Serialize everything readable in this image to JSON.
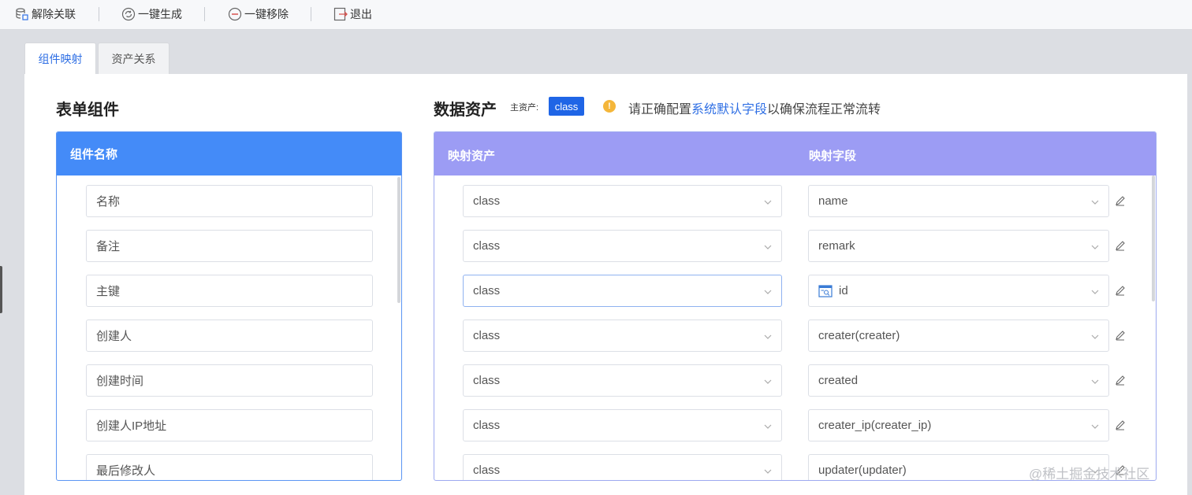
{
  "toolbar": {
    "unlink_label": "解除关联",
    "generate_label": "一键生成",
    "remove_label": "一键移除",
    "exit_label": "退出"
  },
  "tabs": [
    {
      "label": "组件映射",
      "active": true
    },
    {
      "label": "资产关系",
      "active": false
    }
  ],
  "form_components": {
    "title": "表单组件",
    "column_header": "组件名称",
    "items": [
      "名称",
      "备注",
      "主键",
      "创建人",
      "创建时间",
      "创建人IP地址",
      "最后修改人"
    ]
  },
  "data_assets": {
    "title": "数据资产",
    "main_asset_label": "主资产:",
    "main_asset_value": "class",
    "warning_prefix": "请正确配置",
    "warning_link": "系统默认字段",
    "warning_suffix": "以确保流程正常流转",
    "column_asset": "映射资产",
    "column_field": "映射字段",
    "rows": [
      {
        "asset": "class",
        "field": "name"
      },
      {
        "asset": "class",
        "field": "remark"
      },
      {
        "asset": "class",
        "field": "id"
      },
      {
        "asset": "class",
        "field": "creater(creater)"
      },
      {
        "asset": "class",
        "field": "created"
      },
      {
        "asset": "class",
        "field": "creater_ip(creater_ip)"
      },
      {
        "asset": "class",
        "field": "updater(updater)"
      }
    ]
  },
  "watermark": "@稀土掘金技术社区",
  "colors": {
    "left_header": "#448bf8",
    "right_header": "#9c9cf4",
    "accent": "#1f65e6",
    "warning": "#f4b63a"
  }
}
